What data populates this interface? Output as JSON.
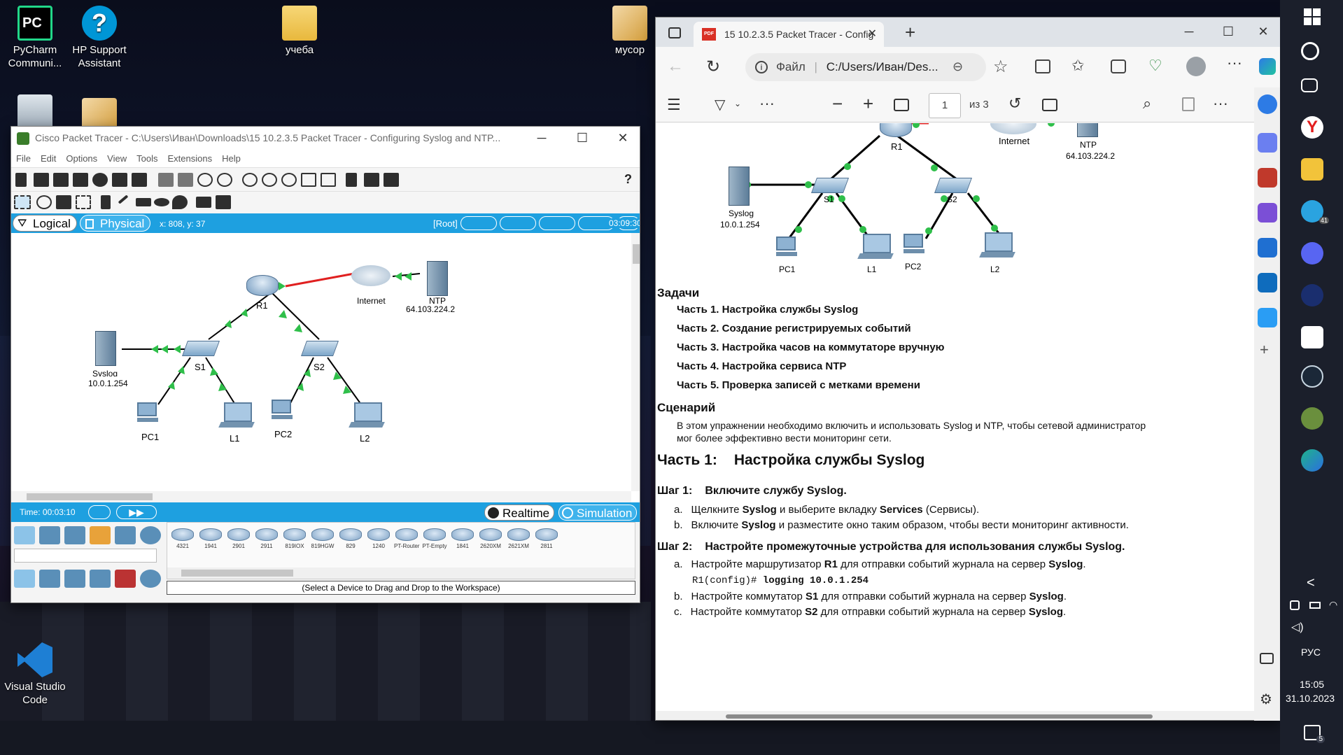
{
  "desktop": {
    "icons": [
      {
        "label": "PyCharm\nCommuni...",
        "short": "PC"
      },
      {
        "label": "HP Support\nAssistant",
        "short": "?"
      },
      {
        "label": "учеба"
      },
      {
        "label": "мусор"
      },
      {
        "label": "Visual Studio\nCode"
      }
    ]
  },
  "packet_tracer": {
    "title": "Cisco Packet Tracer - C:\\Users\\Иван\\Downloads\\15 10.2.3.5 Packet Tracer - Configuring Syslog and NTP...",
    "menu": [
      "File",
      "Edit",
      "Options",
      "View",
      "Tools",
      "Extensions",
      "Help"
    ],
    "help_glyph": "?",
    "tabs": {
      "logical": "Logical",
      "physical": "Physical"
    },
    "coords": "x: 808, y: 37",
    "root_label": "[Root]",
    "clock": "03:09:30",
    "topology": {
      "r1": "R1",
      "s1": "S1",
      "s2": "S2",
      "internet": "Internet",
      "ntp_name": "NTP",
      "ntp_ip": "64.103.224.2",
      "syslog_name": "Syslog",
      "syslog_ip": "10.0.1.254",
      "pc1": "PC1",
      "l1": "L1",
      "pc2": "PC2",
      "l2": "L2"
    },
    "sim": {
      "time": "Time: 00:03:10",
      "realtime": "Realtime",
      "simulation": "Simulation"
    },
    "device_models": [
      "4321",
      "1941",
      "2901",
      "2911",
      "819IOX",
      "819HGW",
      "829",
      "1240",
      "PT-Router",
      "PT-Empty",
      "1841",
      "2620XM",
      "2621XM",
      "2811"
    ],
    "status": "(Select a Device to Drag and Drop to the Workspace)"
  },
  "edge": {
    "tab_title": "15 10.2.3.5 Packet Tracer - Config",
    "pdf_badge": "PDF",
    "url_prefix": "Файл",
    "url": "C:/Users/Иван/Des...",
    "page_current": "1",
    "page_total": "из 3",
    "doc": {
      "topology": {
        "r1": "R1",
        "internet": "Internet",
        "ntp_name": "NTP",
        "ntp_ip": "64.103.224.2",
        "syslog_name": "Syslog",
        "syslog_ip": "10.0.1.254",
        "s1": "S1",
        "s2": "S2",
        "pc1": "PC1",
        "l1": "L1",
        "pc2": "PC2",
        "l2": "L2"
      },
      "tasks_heading": "Задачи",
      "tasks": [
        "Часть 1. Настройка службы Syslog",
        "Часть 2. Создание регистрируемых событий",
        "Часть 3. Настройка часов на коммутаторе вручную",
        "Часть 4. Настройка сервиса NTP",
        "Часть 5. Проверка записей с метками времени"
      ],
      "scenario_heading": "Сценарий",
      "scenario_line1": "В этом упражнении необходимо включить и использовать Syslog и NTP, чтобы сетевой администратор",
      "scenario_line2": "мог более эффективно вести мониторинг сети.",
      "part1_num": "Часть 1:",
      "part1_title": "Настройка службы Syslog",
      "step1_num": "Шаг 1:",
      "step1_title": "Включите службу Syslog.",
      "step1_a": {
        "marker": "a.",
        "t1": "Щелкните ",
        "b1": "Syslog",
        "t2": " и выберите вкладку ",
        "b2": "Services",
        "t3": " (Сервисы)."
      },
      "step1_b": {
        "marker": "b.",
        "t1": "Включите ",
        "b1": "Syslog",
        "t2": " и разместите окно таким образом, чтобы вести мониторинг активности."
      },
      "step2_num": "Шаг 2:",
      "step2_title": "Настройте промежуточные устройства для использования службы Syslog.",
      "step2_a": {
        "marker": "a.",
        "t1": "Настройте маршрутизатор ",
        "b1": "R1",
        "t2": " для отправки событий журнала на сервер ",
        "b2": "Syslog",
        "t3": "."
      },
      "cli_prompt": "R1(config)#",
      "cli_cmd": "logging 10.0.1.254",
      "step2_b": {
        "marker": "b.",
        "t1": "Настройте коммутатор ",
        "b1": "S1",
        "t2": " для отправки событий журнала на сервер ",
        "b2": "Syslog",
        "t3": "."
      },
      "step2_c": {
        "marker": "c.",
        "t1": "Настройте коммутатор ",
        "b1": "S2",
        "t2": " для отправки событий журнала на сервер ",
        "b2": "Syslog",
        "t3": "."
      }
    }
  },
  "taskbar": {
    "lang": "РУС",
    "time": "15:05",
    "date": "31.10.2023",
    "notif_count": "5",
    "telegram_badge": "41",
    "tray_chevron": "<"
  },
  "colors": {
    "pt_blue": "#1ea0e0",
    "link_green": "#2fbf4a",
    "link_red": "#e02020",
    "taskbar": "#1b1f2b"
  }
}
